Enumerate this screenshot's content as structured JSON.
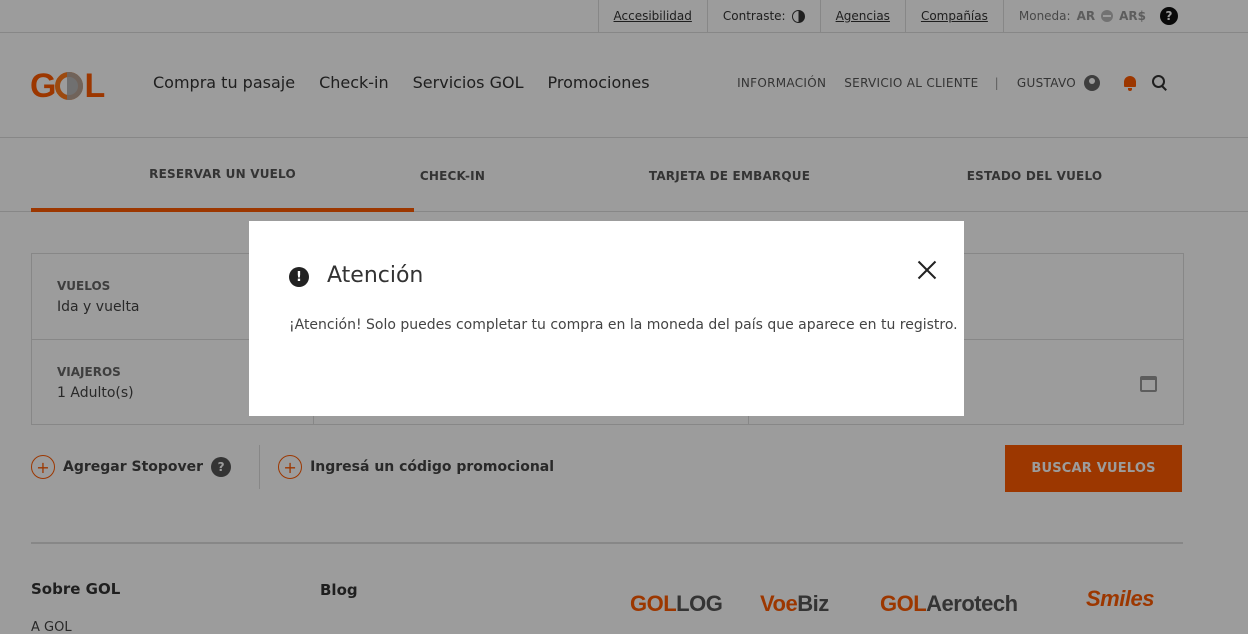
{
  "util": {
    "accessibility": "Accesibilidad",
    "contrast": "Contraste:",
    "agencies": "Agencias",
    "companies": "Compañías",
    "currency_label": "Moneda:",
    "currency_a": "AR",
    "currency_b": "AR$",
    "help": "?"
  },
  "header": {
    "logo": "GOL",
    "nav": [
      "Compra tu pasaje",
      "Check-in",
      "Servicios GOL",
      "Promociones"
    ],
    "info": "INFORMACIÓN",
    "customer_service": "SERVICIO AL CLIENTE",
    "separator": "|",
    "user": "GUSTAVO"
  },
  "tabs": [
    "RESERVAR UN VUELO",
    "CHECK-IN",
    "TARJETA DE EMBARQUE",
    "ESTADO DEL VUELO"
  ],
  "form": {
    "flights_label": "VUELOS",
    "flights_value": "Ida y vuelta",
    "travelers_label": "VIAJEROS",
    "travelers_value": "1 Adulto(s)"
  },
  "extras": {
    "stopover": "Agregar Stopover",
    "promo": "Ingresá un código promocional",
    "plus": "+",
    "help": "?"
  },
  "search_button": "BUSCAR VUELOS",
  "footer": {
    "col1_title": "Sobre GOL",
    "col1_link": "A GOL",
    "col2_title": "Blog",
    "brands": {
      "gollog_a": "GOL",
      "gollog_b": "LOG",
      "voebiz_a": "Voe",
      "voebiz_b": "Biz",
      "aerotech_a": "GOL",
      "aerotech_b": "Aerotech",
      "smiles": "Smiles"
    }
  },
  "modal": {
    "icon": "!",
    "title": "Atención",
    "message": "¡Atención! Solo puedes completar tu compra en la moneda del país que aparece en tu registro."
  },
  "colors": {
    "brand_orange": "#ff5a00",
    "overlay": "rgba(0,0,0,0.39)"
  }
}
